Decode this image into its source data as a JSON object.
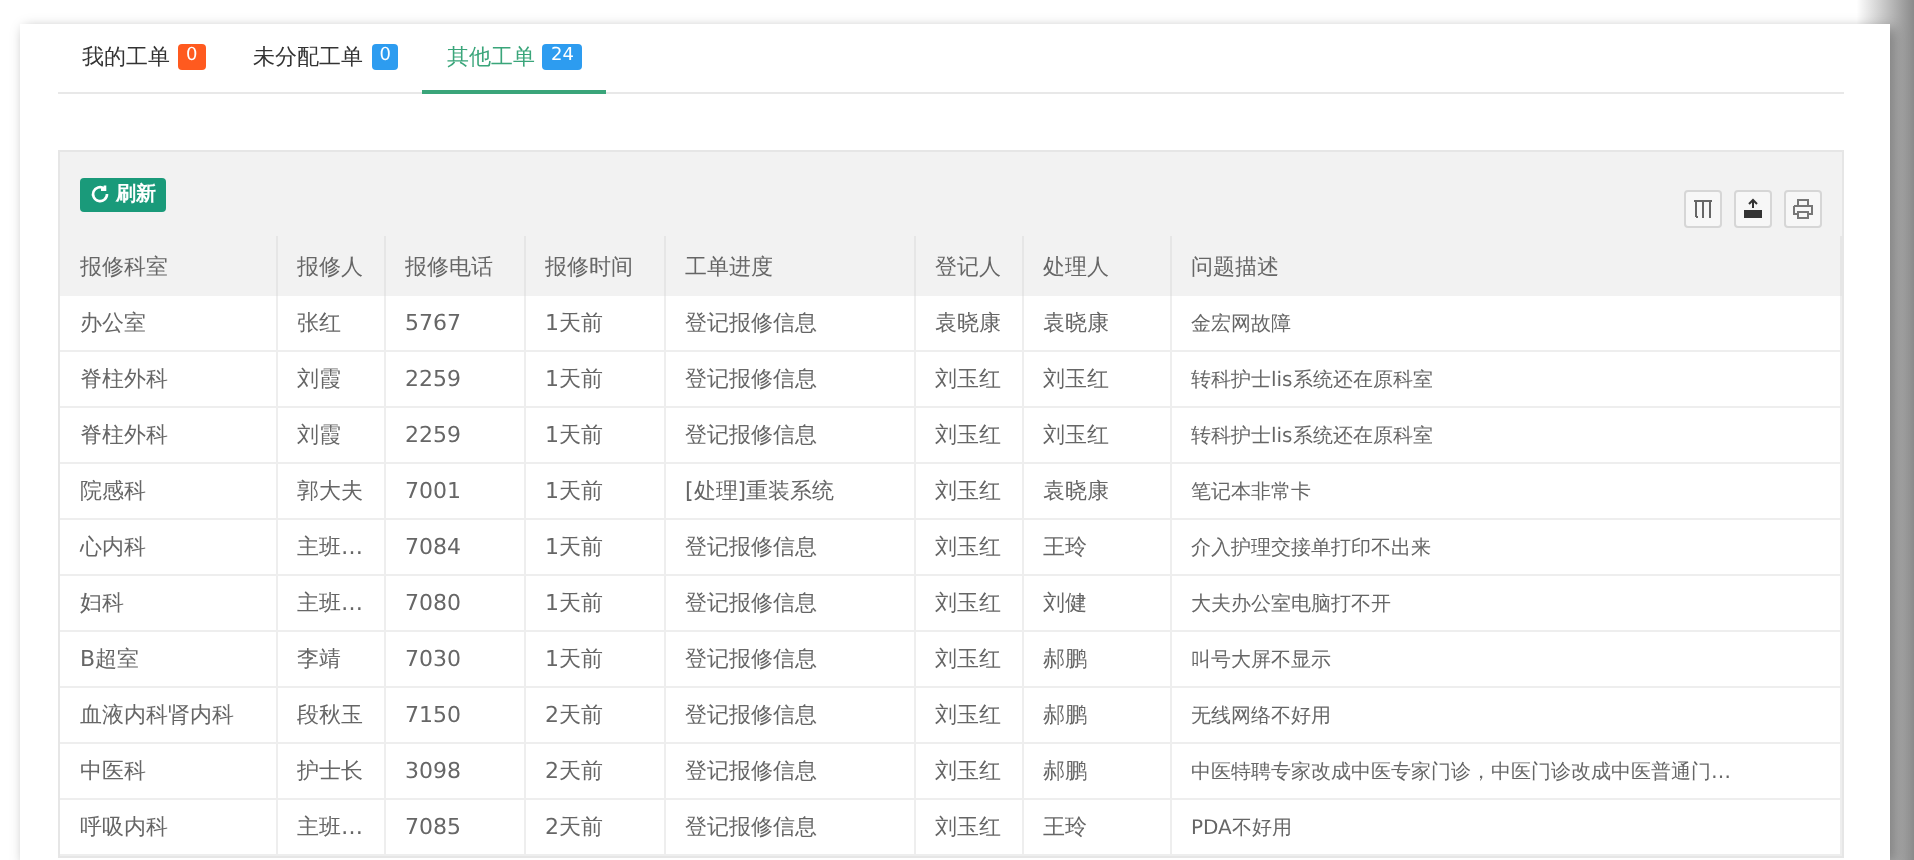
{
  "tabs": [
    {
      "label": "我的工单",
      "count": "0",
      "color": "#ff5a1f",
      "selected": false
    },
    {
      "label": "未分配工单",
      "count": "0",
      "color": "#2d9cf0",
      "selected": false
    },
    {
      "label": "其他工单",
      "count": "24",
      "color": "#2d9cf0",
      "selected": true
    }
  ],
  "toolbar": {
    "refresh_button": "刷新",
    "tools": [
      {
        "kind": "columns"
      },
      {
        "kind": "export"
      },
      {
        "kind": "print"
      }
    ]
  },
  "table": {
    "columns": [
      "报修科室",
      "报修人",
      "报修电话",
      "报修时间",
      "工单进度",
      "登记人",
      "处理人",
      "问题描述"
    ],
    "rows": [
      [
        "办公室",
        "张红",
        "5767",
        "1天前",
        "登记报修信息",
        "袁晓康",
        "袁晓康",
        "金宏网故障"
      ],
      [
        "脊柱外科",
        "刘霞",
        "2259",
        "1天前",
        "登记报修信息",
        "刘玉红",
        "刘玉红",
        "转科护士lis系统还在原科室"
      ],
      [
        "脊柱外科",
        "刘霞",
        "2259",
        "1天前",
        "登记报修信息",
        "刘玉红",
        "刘玉红",
        "转科护士lis系统还在原科室"
      ],
      [
        "院感科",
        "郭大夫",
        "7001",
        "1天前",
        "[处理]重装系统",
        "刘玉红",
        "袁晓康",
        "笔记本非常卡"
      ],
      [
        "心内科",
        "主班…",
        "7084",
        "1天前",
        "登记报修信息",
        "刘玉红",
        "王玲",
        "介入护理交接单打印不出来"
      ],
      [
        "妇科",
        "主班…",
        "7080",
        "1天前",
        "登记报修信息",
        "刘玉红",
        "刘健",
        "大夫办公室电脑打不开"
      ],
      [
        "B超室",
        "李靖",
        "7030",
        "1天前",
        "登记报修信息",
        "刘玉红",
        "郝鹏",
        "叫号大屏不显示"
      ],
      [
        "血液内科肾内科",
        "段秋玉",
        "7150",
        "2天前",
        "登记报修信息",
        "刘玉红",
        "郝鹏",
        "无线网络不好用"
      ],
      [
        "中医科",
        "护士长",
        "3098",
        "2天前",
        "登记报修信息",
        "刘玉红",
        "郝鹏",
        "中医特聘专家改成中医专家门诊，中医门诊改成中医普通门…"
      ],
      [
        "呼吸内科",
        "主班…",
        "7085",
        "2天前",
        "登记报修信息",
        "刘玉红",
        "王玲",
        "PDA不好用"
      ]
    ]
  }
}
